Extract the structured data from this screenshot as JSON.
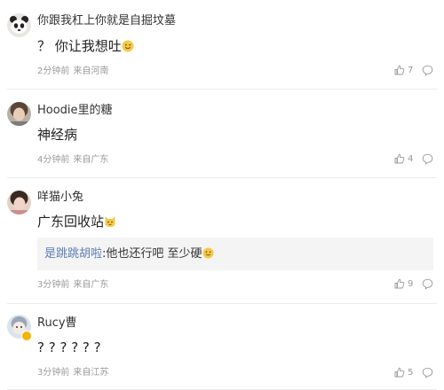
{
  "comments": [
    {
      "user": "你跟我杠上你就是自掘坟墓",
      "text": "？ 你让我想吐",
      "time": "2分钟前",
      "source": "来自河南",
      "likes": "7",
      "avatar_icon": "panda-avatar-icon"
    },
    {
      "user": "Hoodie里的糖",
      "text": "神经病",
      "time": "4分钟前",
      "source": "来自广东",
      "likes": "4",
      "avatar_icon": "girl-avatar-icon"
    },
    {
      "user": "咩猫小兔",
      "text": "广东回收站",
      "time": "3分钟前",
      "source": "来自广东",
      "likes": "9",
      "avatar_icon": "girl-avatar-icon",
      "reply": {
        "name": "是跳跳胡啦",
        "text": ":他也还行吧 至少硬"
      }
    },
    {
      "user": "Rucy曹",
      "text": "? ? ? ? ? ?",
      "time": "3分钟前",
      "source": "来自江苏",
      "likes": "5",
      "avatar_icon": "cartoon-avatar-icon",
      "verified": true
    }
  ],
  "colors": {
    "link": "#5b7db8",
    "meta": "#999999",
    "reply_bg": "#f4f4f4",
    "badge": "#f4b400"
  }
}
